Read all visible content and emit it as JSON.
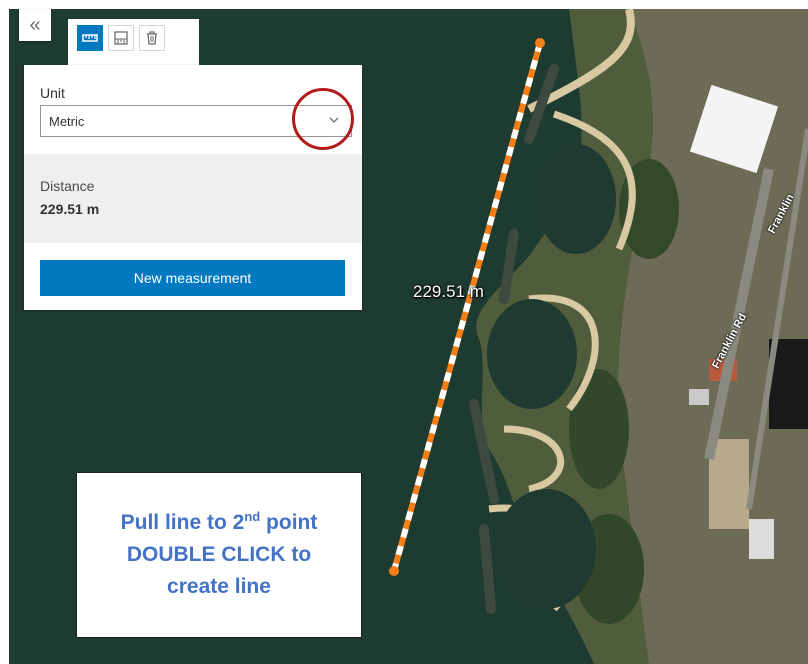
{
  "map": {
    "measurement_label": "229.51 m",
    "roads": [
      "Franklin Rd",
      "Franklin"
    ],
    "line_colors": {
      "primary": "#f57f17",
      "secondary": "#ffffff"
    }
  },
  "toolbar": {
    "collapse_icon": "double-chevron-left-icon",
    "tools": [
      {
        "name": "distance-tool",
        "icon": "ruler-distance-icon",
        "active": true
      },
      {
        "name": "area-tool",
        "icon": "area-measure-icon",
        "active": false
      },
      {
        "name": "clear-tool",
        "icon": "trash-icon",
        "active": false
      }
    ]
  },
  "panel": {
    "unit_label": "Unit",
    "unit_value": "Metric",
    "distance_label": "Distance",
    "distance_value": "229.51 m",
    "new_button_label": "New measurement"
  },
  "callout": {
    "line1_prefix": "Pull line to 2",
    "line1_sup": "nd",
    "line1_suffix": " point",
    "line2": "DOUBLE CLICK to",
    "line3": "create line"
  },
  "colors": {
    "accent": "#0079c1",
    "callout_text": "#4472c4",
    "highlight": "#b31b1b"
  }
}
